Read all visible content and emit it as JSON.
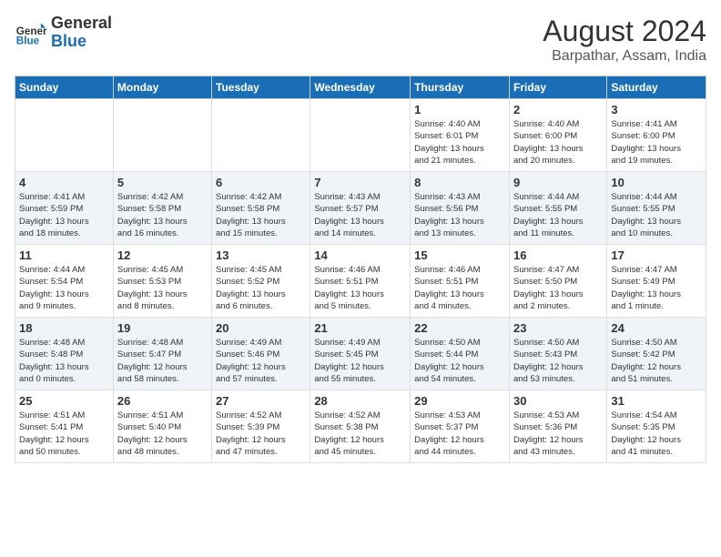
{
  "logo": {
    "general": "General",
    "blue": "Blue"
  },
  "title": "August 2024",
  "subtitle": "Barpathar, Assam, India",
  "days_of_week": [
    "Sunday",
    "Monday",
    "Tuesday",
    "Wednesday",
    "Thursday",
    "Friday",
    "Saturday"
  ],
  "weeks": [
    [
      {
        "day": "",
        "info": ""
      },
      {
        "day": "",
        "info": ""
      },
      {
        "day": "",
        "info": ""
      },
      {
        "day": "",
        "info": ""
      },
      {
        "day": "1",
        "info": "Sunrise: 4:40 AM\nSunset: 6:01 PM\nDaylight: 13 hours\nand 21 minutes."
      },
      {
        "day": "2",
        "info": "Sunrise: 4:40 AM\nSunset: 6:00 PM\nDaylight: 13 hours\nand 20 minutes."
      },
      {
        "day": "3",
        "info": "Sunrise: 4:41 AM\nSunset: 6:00 PM\nDaylight: 13 hours\nand 19 minutes."
      }
    ],
    [
      {
        "day": "4",
        "info": "Sunrise: 4:41 AM\nSunset: 5:59 PM\nDaylight: 13 hours\nand 18 minutes."
      },
      {
        "day": "5",
        "info": "Sunrise: 4:42 AM\nSunset: 5:58 PM\nDaylight: 13 hours\nand 16 minutes."
      },
      {
        "day": "6",
        "info": "Sunrise: 4:42 AM\nSunset: 5:58 PM\nDaylight: 13 hours\nand 15 minutes."
      },
      {
        "day": "7",
        "info": "Sunrise: 4:43 AM\nSunset: 5:57 PM\nDaylight: 13 hours\nand 14 minutes."
      },
      {
        "day": "8",
        "info": "Sunrise: 4:43 AM\nSunset: 5:56 PM\nDaylight: 13 hours\nand 13 minutes."
      },
      {
        "day": "9",
        "info": "Sunrise: 4:44 AM\nSunset: 5:55 PM\nDaylight: 13 hours\nand 11 minutes."
      },
      {
        "day": "10",
        "info": "Sunrise: 4:44 AM\nSunset: 5:55 PM\nDaylight: 13 hours\nand 10 minutes."
      }
    ],
    [
      {
        "day": "11",
        "info": "Sunrise: 4:44 AM\nSunset: 5:54 PM\nDaylight: 13 hours\nand 9 minutes."
      },
      {
        "day": "12",
        "info": "Sunrise: 4:45 AM\nSunset: 5:53 PM\nDaylight: 13 hours\nand 8 minutes."
      },
      {
        "day": "13",
        "info": "Sunrise: 4:45 AM\nSunset: 5:52 PM\nDaylight: 13 hours\nand 6 minutes."
      },
      {
        "day": "14",
        "info": "Sunrise: 4:46 AM\nSunset: 5:51 PM\nDaylight: 13 hours\nand 5 minutes."
      },
      {
        "day": "15",
        "info": "Sunrise: 4:46 AM\nSunset: 5:51 PM\nDaylight: 13 hours\nand 4 minutes."
      },
      {
        "day": "16",
        "info": "Sunrise: 4:47 AM\nSunset: 5:50 PM\nDaylight: 13 hours\nand 2 minutes."
      },
      {
        "day": "17",
        "info": "Sunrise: 4:47 AM\nSunset: 5:49 PM\nDaylight: 13 hours\nand 1 minute."
      }
    ],
    [
      {
        "day": "18",
        "info": "Sunrise: 4:48 AM\nSunset: 5:48 PM\nDaylight: 13 hours\nand 0 minutes."
      },
      {
        "day": "19",
        "info": "Sunrise: 4:48 AM\nSunset: 5:47 PM\nDaylight: 12 hours\nand 58 minutes."
      },
      {
        "day": "20",
        "info": "Sunrise: 4:49 AM\nSunset: 5:46 PM\nDaylight: 12 hours\nand 57 minutes."
      },
      {
        "day": "21",
        "info": "Sunrise: 4:49 AM\nSunset: 5:45 PM\nDaylight: 12 hours\nand 55 minutes."
      },
      {
        "day": "22",
        "info": "Sunrise: 4:50 AM\nSunset: 5:44 PM\nDaylight: 12 hours\nand 54 minutes."
      },
      {
        "day": "23",
        "info": "Sunrise: 4:50 AM\nSunset: 5:43 PM\nDaylight: 12 hours\nand 53 minutes."
      },
      {
        "day": "24",
        "info": "Sunrise: 4:50 AM\nSunset: 5:42 PM\nDaylight: 12 hours\nand 51 minutes."
      }
    ],
    [
      {
        "day": "25",
        "info": "Sunrise: 4:51 AM\nSunset: 5:41 PM\nDaylight: 12 hours\nand 50 minutes."
      },
      {
        "day": "26",
        "info": "Sunrise: 4:51 AM\nSunset: 5:40 PM\nDaylight: 12 hours\nand 48 minutes."
      },
      {
        "day": "27",
        "info": "Sunrise: 4:52 AM\nSunset: 5:39 PM\nDaylight: 12 hours\nand 47 minutes."
      },
      {
        "day": "28",
        "info": "Sunrise: 4:52 AM\nSunset: 5:38 PM\nDaylight: 12 hours\nand 45 minutes."
      },
      {
        "day": "29",
        "info": "Sunrise: 4:53 AM\nSunset: 5:37 PM\nDaylight: 12 hours\nand 44 minutes."
      },
      {
        "day": "30",
        "info": "Sunrise: 4:53 AM\nSunset: 5:36 PM\nDaylight: 12 hours\nand 43 minutes."
      },
      {
        "day": "31",
        "info": "Sunrise: 4:54 AM\nSunset: 5:35 PM\nDaylight: 12 hours\nand 41 minutes."
      }
    ]
  ]
}
